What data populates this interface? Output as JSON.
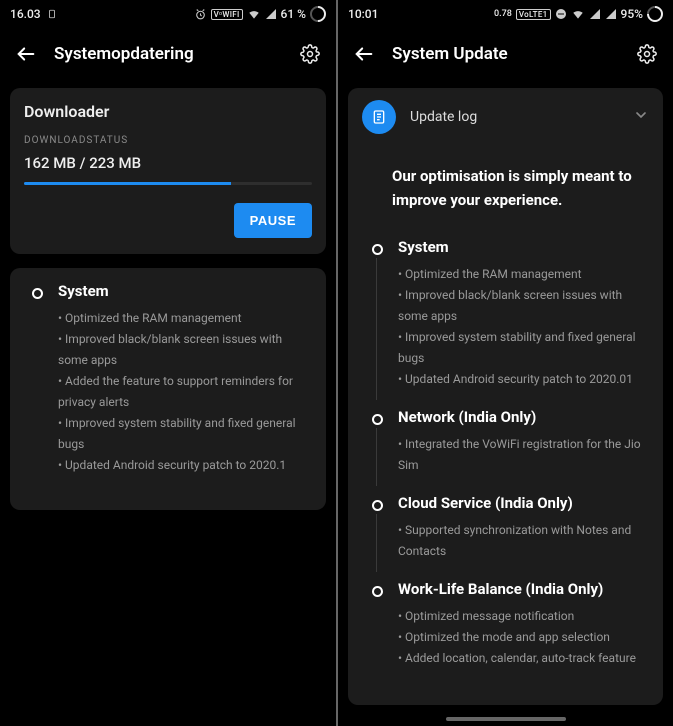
{
  "left": {
    "status": {
      "time": "16.03",
      "battery": "61 %",
      "vowifi": "VᵒWIFI"
    },
    "appbar": {
      "title": "Systemopdatering"
    },
    "downloader": {
      "heading": "Downloader",
      "status_label": "DOWNLOADSTATUS",
      "progress_text": "162 MB / 223 MB",
      "progress_pct": 72,
      "pause_label": "PAUSE"
    },
    "notes": [
      {
        "title": "System",
        "items": [
          "Optimized the RAM management",
          "Improved black/blank screen issues with some apps",
          "Added the feature to support reminders for privacy alerts",
          "Improved system stability and fixed general bugs",
          "Updated Android security patch to 2020.1"
        ]
      }
    ]
  },
  "right": {
    "status": {
      "time": "10:01",
      "battery": "95%",
      "rate": "0.78",
      "volte": "VoLTE1"
    },
    "appbar": {
      "title": "System Update"
    },
    "log": {
      "heading": "Update log",
      "tagline": "Our optimisation is simply meant to improve your experience."
    },
    "notes": [
      {
        "title": "System",
        "items": [
          "Optimized the RAM management",
          "Improved black/blank screen issues with some apps",
          "Improved system stability and fixed general bugs",
          "Updated Android security patch to 2020.01"
        ]
      },
      {
        "title": "Network (India Only)",
        "items": [
          "Integrated the VoWiFi registration for the Jio Sim"
        ]
      },
      {
        "title": "Cloud Service (India Only)",
        "items": [
          "Supported synchronization with Notes and Contacts"
        ]
      },
      {
        "title": "Work-Life Balance (India Only)",
        "items": [
          "Optimized message notification",
          "Optimized the mode and app selection",
          "Added location, calendar, auto-track feature"
        ]
      }
    ]
  }
}
